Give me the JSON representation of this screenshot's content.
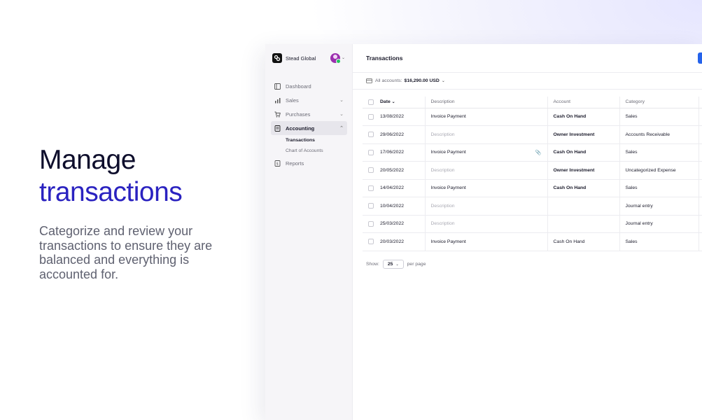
{
  "hero": {
    "title_line1": "Manage",
    "title_line2": "transactions",
    "description": "Categorize and review your transactions to ensure they are balanced and everything is accounted for."
  },
  "sidebar": {
    "org_name": "Stead Global",
    "items": [
      {
        "label": "Dashboard",
        "icon": "dashboard-icon"
      },
      {
        "label": "Sales",
        "icon": "bar-chart-icon",
        "caret": "⌄"
      },
      {
        "label": "Purchases",
        "icon": "cart-icon",
        "caret": "⌄"
      },
      {
        "label": "Accounting",
        "icon": "ledger-icon",
        "caret": "⌃",
        "active": true
      },
      {
        "label": "Reports",
        "icon": "report-icon"
      }
    ],
    "sub_items": [
      {
        "label": "Transactions",
        "active": true
      },
      {
        "label": "Chart of Accounts"
      }
    ]
  },
  "header": {
    "title": "Transactions"
  },
  "filter": {
    "label": "All accounts:",
    "value": "$16,290.00 USD"
  },
  "table": {
    "columns": {
      "date": "Date",
      "description": "Description",
      "account": "Account",
      "category": "Category"
    },
    "rows": [
      {
        "date": "13/08/2022",
        "description": "Invoice Payment",
        "account": "Cash On Hand",
        "category": "Sales"
      },
      {
        "date": "29/06/2022",
        "description": "Description",
        "account": "Owner Investment",
        "category": "Accounts Receivable"
      },
      {
        "date": "17/06/2022",
        "description": "Invoice Payment",
        "account": "Cash On Hand",
        "category": "Sales"
      },
      {
        "date": "20/05/2022",
        "description": "Description",
        "account": "Owner Investment",
        "category": "Uncategorized Expense"
      },
      {
        "date": "14/04/2022",
        "description": "Invoice Payment",
        "account": "Cash On Hand",
        "category": "Sales"
      },
      {
        "date": "10/04/2022",
        "description": "Description",
        "account": "",
        "category": "Journal entry"
      },
      {
        "date": "25/03/2022",
        "description": "Description",
        "account": "",
        "category": "Journal entry"
      },
      {
        "date": "20/03/2022",
        "description": "Invoice Payment",
        "account": "Cash On Hand",
        "category": "Sales"
      }
    ]
  },
  "pager": {
    "show_label": "Show:",
    "per_page_value": "25",
    "per_page_label": "per page"
  },
  "colors": {
    "accent": "#2a22c0",
    "primary_button": "#2563eb",
    "status_online": "#22c55e"
  }
}
